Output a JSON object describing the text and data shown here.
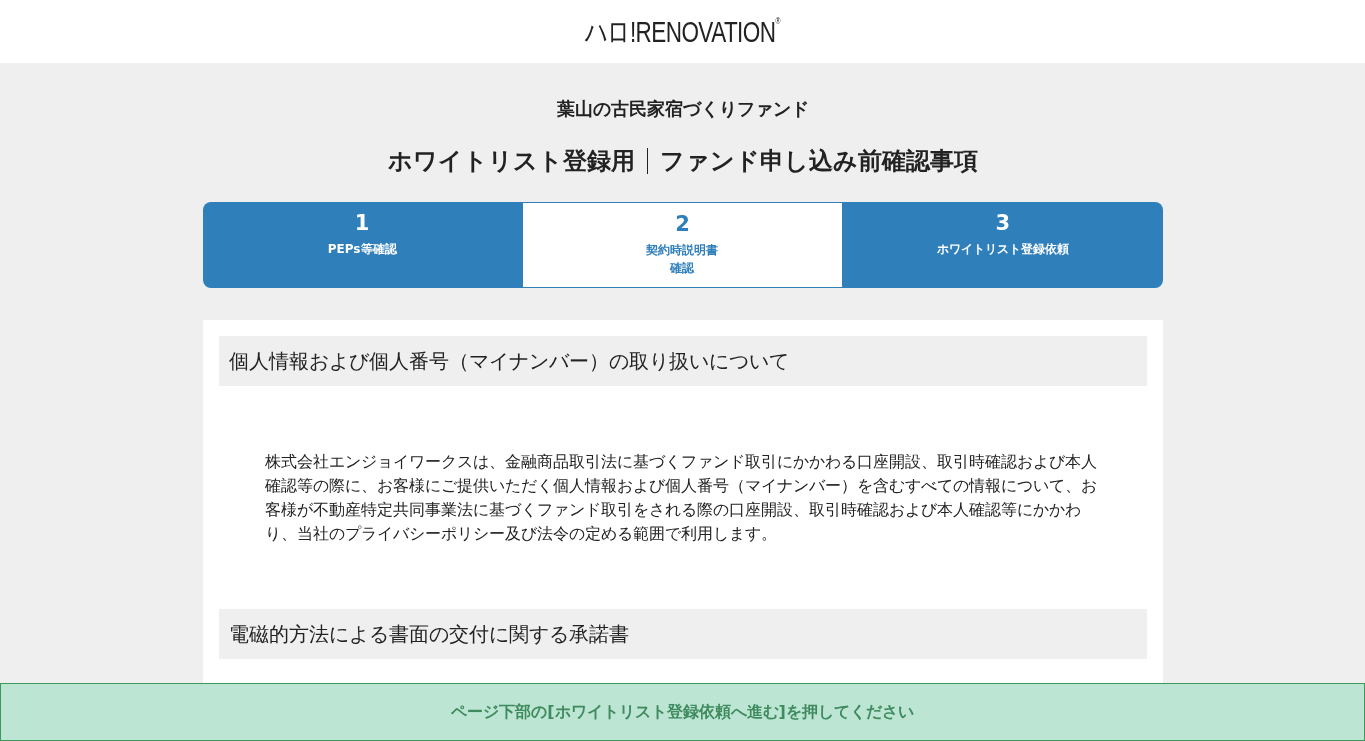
{
  "header": {
    "logo": "ハロ!RENOVATION",
    "logo_mark": "®"
  },
  "fund_name": "葉山の古民家宿づくりファンド",
  "page_title": {
    "left": "ホワイトリスト登録用",
    "right": "ファンド申し込み前確認事項"
  },
  "steps": [
    {
      "number": "1",
      "label_lines": [
        "PEPs等確認"
      ],
      "selected": false
    },
    {
      "number": "2",
      "label_lines": [
        "契約時説明書",
        "確認"
      ],
      "selected": true
    },
    {
      "number": "3",
      "label_lines": [
        "ホワイトリスト登録依頼"
      ],
      "selected": false
    }
  ],
  "sections": [
    {
      "heading": "個人情報および個人番号（マイナンバー）の取り扱いについて",
      "body": "株式会社エンジョイワークスは、金融商品取引法に基づくファンド取引にかかわる口座開設、取引時確認および本人確認等の際に、お客様にご提供いただく個人情報および個人番号（マイナンバー）を含むすべての情報について、お客様が不動産特定共同事業法に基づくファンド取引をされる際の口座開設、取引時確認および本人確認等にかかわり、当社のプライバシーポリシー及び法令の定める範囲で利用します。"
    },
    {
      "heading": "電磁的方法による書面の交付に関する承諾書"
    }
  ],
  "notice": "ページ下部の[ホワイトリスト登録依頼へ進む]を押してください"
}
